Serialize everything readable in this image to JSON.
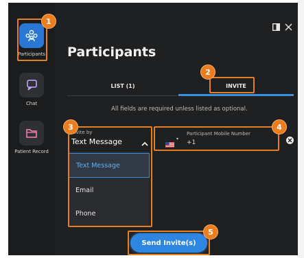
{
  "sidebar": {
    "items": [
      {
        "label": "Participants",
        "icon": "participants-icon",
        "active": true
      },
      {
        "label": "Chat",
        "icon": "chat-icon",
        "active": false
      },
      {
        "label": "Patient Record",
        "icon": "folder-icon",
        "active": false
      }
    ]
  },
  "header": {
    "title": "Participants",
    "icons": [
      "panel-icon",
      "close-icon"
    ]
  },
  "tabs": [
    {
      "label": "LIST (1)",
      "active": false
    },
    {
      "label": "INVITE",
      "active": true
    }
  ],
  "form": {
    "required_note": "All fields are required unless listed as optional.",
    "invite_by": {
      "label": "Invite by",
      "value": "Text Message",
      "options": [
        "Text Message",
        "Email",
        "Phone"
      ]
    },
    "phone": {
      "country": "US",
      "label": "Participant Mobile Number",
      "value": "+1"
    }
  },
  "send_button": "Send Invite(s)",
  "callouts": [
    "1",
    "2",
    "3",
    "4",
    "5"
  ],
  "colors": {
    "background": "#1f2022",
    "accent": "#2f86e0",
    "highlight": "#e87f22"
  }
}
